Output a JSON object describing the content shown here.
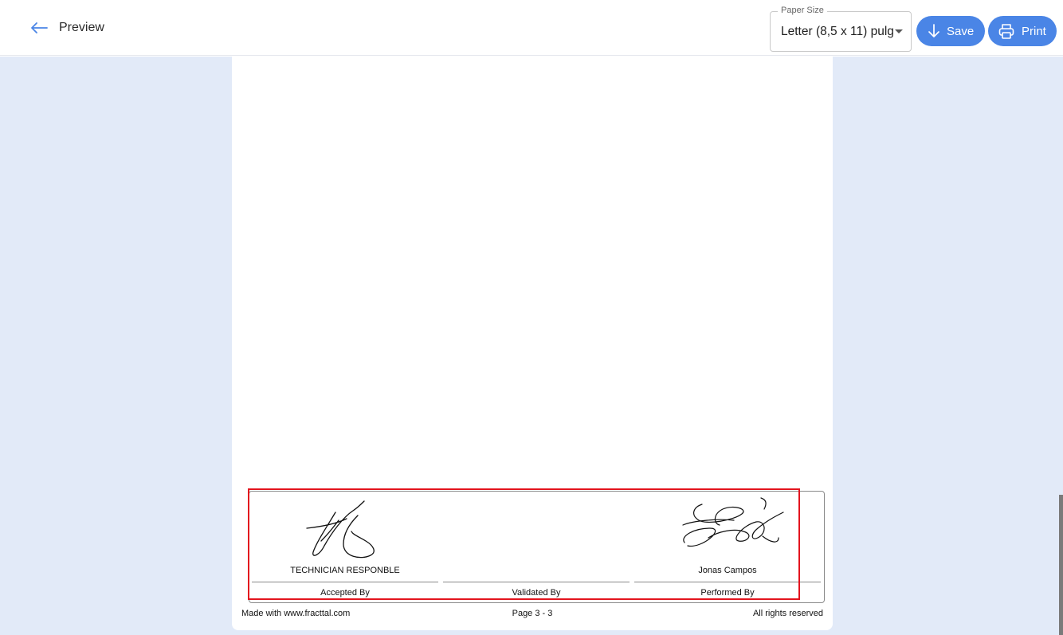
{
  "header": {
    "back_icon": "arrow-left-icon",
    "title": "Preview",
    "paper_size": {
      "label": "Paper Size",
      "value": "Letter (8,5 x 11) pulg",
      "caret_icon": "caret-down-icon"
    },
    "save": {
      "label": "Save",
      "icon": "arrow-down-icon"
    },
    "print": {
      "label": "Print",
      "icon": "printer-icon"
    }
  },
  "signatures": [
    {
      "name": "TECHNICIAN RESPONBLE",
      "role": "Accepted By",
      "has_signature": true
    },
    {
      "name": "",
      "role": "Validated By",
      "has_signature": false
    },
    {
      "name": "Jonas Campos",
      "role": "Performed By",
      "has_signature": true
    }
  ],
  "footer": {
    "left": "Made with www.fracttal.com",
    "center": "Page 3 - 3",
    "right": "All rights reserved"
  },
  "colors": {
    "accent": "#4a85e6",
    "canvas_background": "#e2eaf8",
    "highlight": "#e3141e"
  }
}
